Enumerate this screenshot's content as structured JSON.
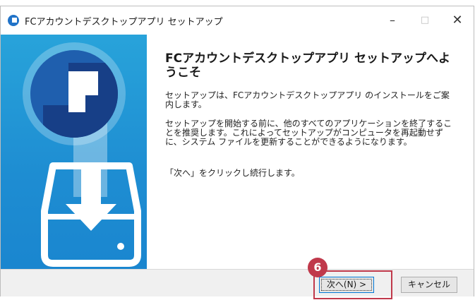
{
  "window": {
    "title": "FCアカウントデスクトップアプリ セットアップ",
    "minimize_label": "–",
    "maximize_label": "□",
    "close_label": "✕"
  },
  "content": {
    "heading": "FCアカウントデスクトップアプリ セットアップへようこそ",
    "paragraph1": "セットアップは、FCアカウントデスクトップアプリ のインストールをご案内します。",
    "paragraph2": "セットアップを開始する前に、他のすべてのアプリケーションを終了することを推奨します。これによってセットアップがコンピュータを再起動せずに、システム ファイルを更新することができるようになります。",
    "paragraph3": "「次へ」をクリックし続行します。"
  },
  "buttons": {
    "next_label": "次へ(N) >",
    "cancel_label": "キャンセル"
  },
  "annotation": {
    "step_number": "6",
    "highlight_color": "#c0394b"
  },
  "icons": {
    "app_icon": "fc-app-logo-icon",
    "panel_logo": "fc-logo-circle-icon",
    "download": "download-drive-icon"
  },
  "colors": {
    "panel_blue": "#1e8dd2",
    "logo_dark": "#1f5fae"
  }
}
